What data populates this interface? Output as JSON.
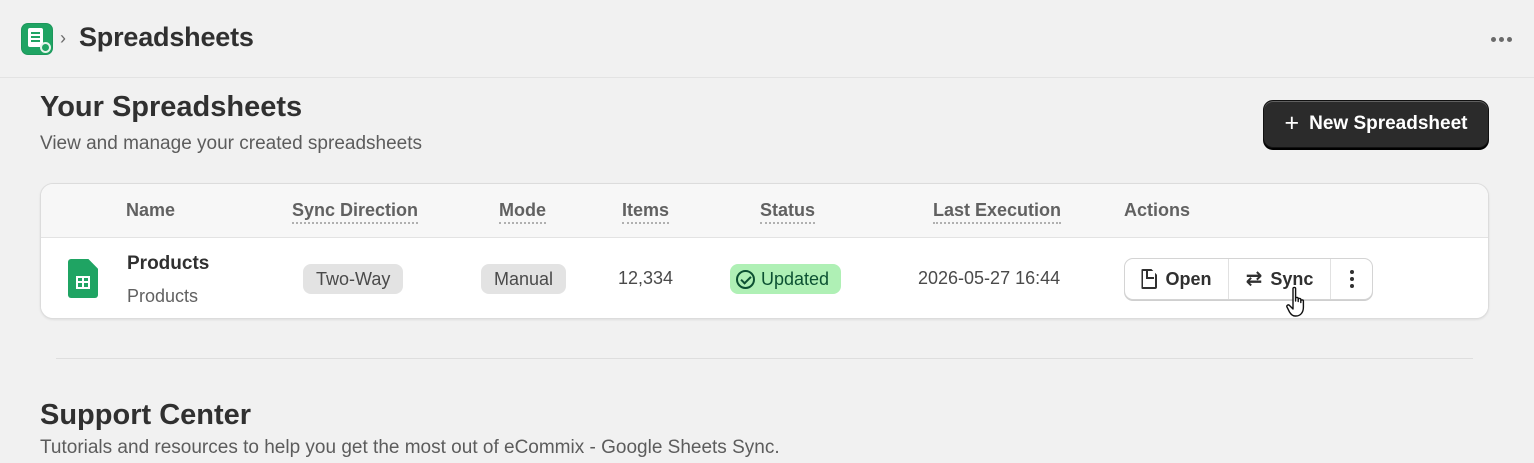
{
  "header": {
    "app_icon": "google-sheets-sync-app-icon",
    "chevron": "›",
    "title": "Spreadsheets",
    "more_icon": "horizontal-dots-icon"
  },
  "main": {
    "title": "Your Spreadsheets",
    "subtitle": "View and manage your created spreadsheets",
    "new_button": {
      "icon": "+",
      "label": "New Spreadsheet"
    }
  },
  "table": {
    "columns": [
      "Name",
      "Sync Direction",
      "Mode",
      "Items",
      "Status",
      "Last Execution",
      "Actions"
    ],
    "rows": [
      {
        "icon": "google-sheets-file-icon",
        "name": "Products",
        "subname": "Products",
        "sync_direction": "Two-Way",
        "mode": "Manual",
        "items": "12,334",
        "status": "Updated",
        "last_execution": "2026-05-27 16:44",
        "actions": {
          "open": "Open",
          "sync": "Sync"
        }
      }
    ]
  },
  "support": {
    "title": "Support Center",
    "subtitle": "Tutorials and resources to help you get the most out of eCommix - Google Sheets Sync."
  },
  "colors": {
    "background": "#f1f1f1",
    "primary_button": "#2b2b2b",
    "status_success_bg": "#aff0b5",
    "status_success_text": "#0c5132",
    "sheets_green": "#1fa463"
  }
}
